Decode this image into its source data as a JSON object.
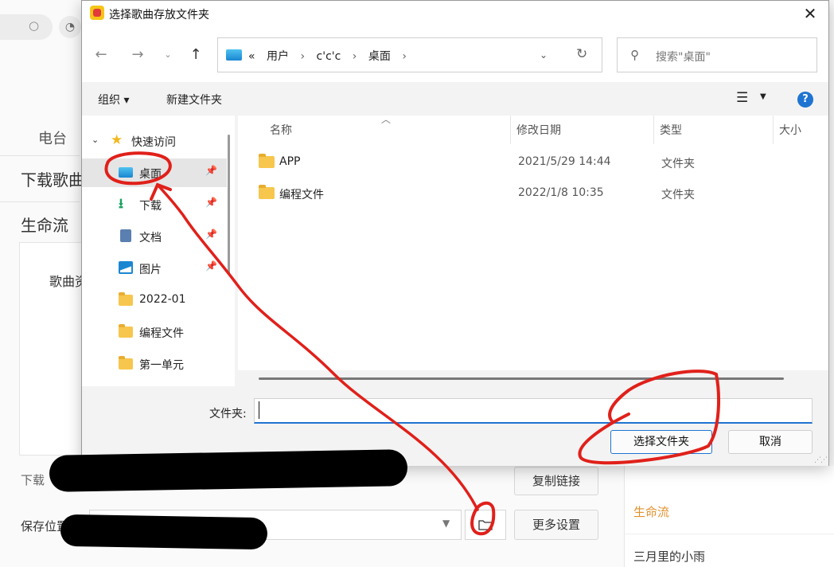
{
  "background": {
    "tab_label": "电台",
    "heading1": "下载歌曲",
    "heading2": "生命流",
    "panel_text": "歌曲资",
    "download_label": "下载",
    "copy_button": "复制链接",
    "save_label": "保存位置",
    "more_settings_button": "更多设置",
    "right_list": [
      "生命流",
      "三月里的小雨"
    ]
  },
  "dialog": {
    "title": "选择歌曲存放文件夹",
    "close_glyph": "✕",
    "address": {
      "prefix": "«",
      "path": [
        "用户",
        "c'c'c",
        "桌面"
      ],
      "separator": "›"
    },
    "search_placeholder": "搜索\"桌面\"",
    "toolbar": {
      "organize": "组织 ▾",
      "new_folder": "新建文件夹"
    },
    "nav": [
      {
        "label": "快速访问",
        "icon": "star-icon",
        "expanded": true
      },
      {
        "label": "桌面",
        "icon": "desktop-icon",
        "pinned": true,
        "selected": true
      },
      {
        "label": "下载",
        "icon": "download-icon",
        "pinned": true
      },
      {
        "label": "文档",
        "icon": "document-icon",
        "pinned": true
      },
      {
        "label": "图片",
        "icon": "picture-icon",
        "pinned": true
      },
      {
        "label": "2022-01",
        "icon": "folder-icon"
      },
      {
        "label": "编程文件",
        "icon": "folder-icon"
      },
      {
        "label": "第一单元",
        "icon": "folder-icon"
      }
    ],
    "columns": [
      "名称",
      "修改日期",
      "类型",
      "大小"
    ],
    "files": [
      {
        "name": "APP",
        "date": "2021/5/29 14:44",
        "type": "文件夹"
      },
      {
        "name": "编程文件",
        "date": "2022/1/8 10:35",
        "type": "文件夹"
      }
    ],
    "folder_label": "文件夹:",
    "folder_value": "",
    "select_button": "选择文件夹",
    "cancel_button": "取消"
  },
  "colors": {
    "accent": "#1f74d1",
    "annotation_red": "#e0201a",
    "right_list_active": "#e0922f"
  }
}
